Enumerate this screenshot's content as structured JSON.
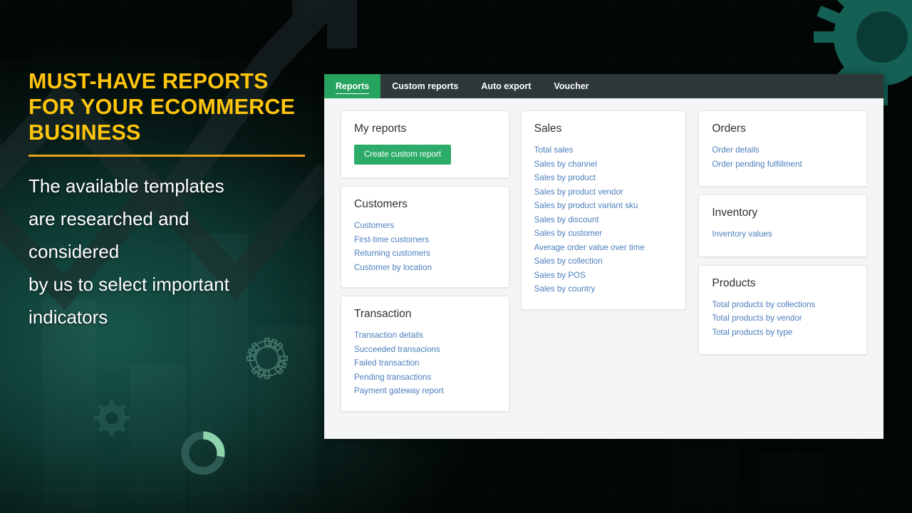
{
  "promo": {
    "headline": "Must-have reports\nfor your\necommerce business",
    "body": "The available templates\nare researched and\nconsidered\nby us to select important\nindicators",
    "accent_color": "#FFC50D",
    "rule_color": "#E8A317"
  },
  "app": {
    "accent_green": "#25A35F",
    "button_green": "#2CAC68",
    "tabbar_bg": "#2E3838",
    "link_color": "#4C7EBD",
    "tabs": [
      {
        "label": "Reports",
        "active": true
      },
      {
        "label": "Custom reports",
        "active": false
      },
      {
        "label": "Auto export",
        "active": false
      },
      {
        "label": "Voucher",
        "active": false
      }
    ],
    "columns": {
      "left": [
        {
          "title": "My reports",
          "button": "Create custom report",
          "links": []
        },
        {
          "title": "Customers",
          "links": [
            "Customers",
            "First-time customers",
            "Returning customers",
            "Customer by location"
          ]
        },
        {
          "title": "Transaction",
          "links": [
            "Transaction details",
            "Succeeded transacions",
            "Failed transaction",
            "Pending transactions",
            "Payment gateway report"
          ]
        }
      ],
      "middle": [
        {
          "title": "Sales",
          "links": [
            "Total sales",
            "Sales by channel",
            "Sales by product",
            "Sales by product vendor",
            "Sales by product variant sku",
            "Sales by discount",
            "Sales by customer",
            "Average order value over time",
            "Sales by collection",
            "Sales by POS",
            "Sales by country"
          ]
        }
      ],
      "right": [
        {
          "title": "Orders",
          "links": [
            "Order details",
            "Order pending fulfillment"
          ]
        },
        {
          "title": "Inventory",
          "links": [
            "Inventory values"
          ]
        },
        {
          "title": "Products",
          "links": [
            "Total products by collections",
            "Total products by vendor",
            "Total products by type"
          ]
        }
      ]
    }
  }
}
